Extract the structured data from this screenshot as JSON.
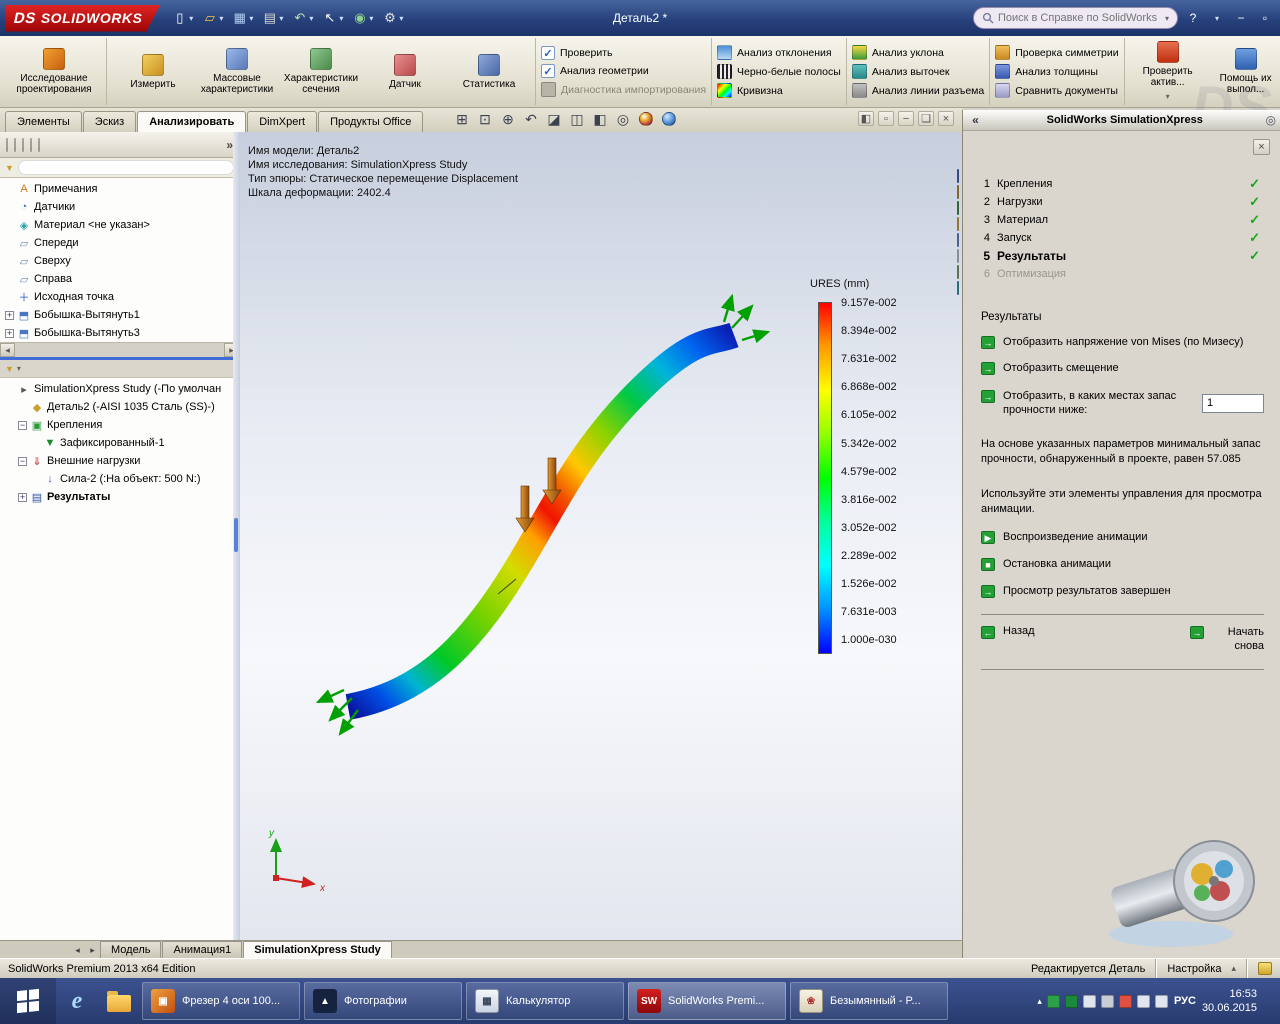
{
  "app": {
    "brand": "SOLIDWORKS",
    "title": "Деталь2 *"
  },
  "titlebar": {
    "search_placeholder": "Поиск в Справке по SolidWorks",
    "tools": [
      "new",
      "open",
      "save",
      "print",
      "undo",
      "select",
      "rebuild",
      "options"
    ],
    "window_controls": [
      "help",
      "minimize",
      "restore"
    ]
  },
  "ribbon": {
    "design_study": "Исследование проектирования",
    "tools": [
      {
        "name": "measure",
        "label": "Измерить"
      },
      {
        "name": "mass-properties",
        "label": "Массовые характеристики"
      },
      {
        "name": "section-properties",
        "label": "Характеристики сечения"
      },
      {
        "name": "sensor",
        "label": "Датчик"
      },
      {
        "name": "statistics",
        "label": "Статистика"
      }
    ],
    "checks": [
      {
        "name": "verify",
        "label": "Проверить",
        "checked": true
      },
      {
        "name": "geometry-analysis",
        "label": "Анализ геометрии",
        "checked": true
      },
      {
        "name": "import-diagnostics",
        "label": "Диагностика импортирования",
        "checked": false
      }
    ],
    "columns": [
      [
        {
          "name": "deviation-analysis",
          "label": "Анализ отклонения"
        },
        {
          "name": "zebra-stripes",
          "label": "Черно-белые полосы"
        },
        {
          "name": "curvature",
          "label": "Кривизна"
        }
      ],
      [
        {
          "name": "draft-analysis",
          "label": "Анализ уклона"
        },
        {
          "name": "undercut-analysis",
          "label": "Анализ выточек"
        },
        {
          "name": "parting-line-analysis",
          "label": "Анализ линии разъема"
        }
      ],
      [
        {
          "name": "symmetry-check",
          "label": "Проверка симметрии"
        },
        {
          "name": "thickness-analysis",
          "label": "Анализ толщины"
        },
        {
          "name": "compare-documents",
          "label": "Сравнить документы"
        }
      ]
    ],
    "right_tools": [
      {
        "name": "check-active",
        "label": "Проверить актив..."
      },
      {
        "name": "help-complete",
        "label": "Помощь их выпол..."
      }
    ]
  },
  "command_tabs": [
    {
      "label": "Элементы",
      "active": false
    },
    {
      "label": "Эскиз",
      "active": false
    },
    {
      "label": "Анализировать",
      "active": true
    },
    {
      "label": "DimXpert",
      "active": false
    },
    {
      "label": "Продукты Office",
      "active": false
    }
  ],
  "feature_tree": [
    {
      "icon": "annotations",
      "label": "Примечания"
    },
    {
      "icon": "sensors",
      "label": "Датчики"
    },
    {
      "icon": "material",
      "label": "Материал <не указан>"
    },
    {
      "icon": "plane",
      "label": "Спереди"
    },
    {
      "icon": "plane",
      "label": "Сверху"
    },
    {
      "icon": "plane",
      "label": "Справа"
    },
    {
      "icon": "origin",
      "label": "Исходная точка"
    },
    {
      "icon": "boss-extrude",
      "label": "Бобышка-Вытянуть1",
      "expand": "+"
    },
    {
      "icon": "boss-extrude",
      "label": "Бобышка-Вытянуть3",
      "expand": "+"
    }
  ],
  "sim_tree": [
    {
      "icon": "study",
      "label": "SimulationXpress Study (-По умолчан",
      "indent": 0
    },
    {
      "icon": "part",
      "label": "Деталь2 (-AISI 1035 Сталь (SS)-)",
      "indent": 1
    },
    {
      "icon": "fixtures",
      "label": "Крепления",
      "indent": 1,
      "expand": "-"
    },
    {
      "icon": "fixed",
      "label": "Зафиксированный-1",
      "indent": 2
    },
    {
      "icon": "loads",
      "label": "Внешние нагрузки",
      "indent": 1,
      "expand": "-"
    },
    {
      "icon": "force",
      "label": "Сила-2 (:На объект: 500 N:)",
      "indent": 2
    },
    {
      "icon": "results",
      "label": "Результаты",
      "indent": 1,
      "expand": "+",
      "bold": true
    }
  ],
  "viewport": {
    "info_lines": [
      "Имя модели: Деталь2",
      "Имя исследования: SimulationXpress Study",
      "Тип эпюры: Статическое перемещение Displacement",
      "Шкала деформации: 2402.4"
    ],
    "legend": {
      "title": "URES (mm)",
      "values": [
        "9.157e-002",
        "8.394e-002",
        "7.631e-002",
        "6.868e-002",
        "6.105e-002",
        "5.342e-002",
        "4.579e-002",
        "3.816e-002",
        "3.052e-002",
        "2.289e-002",
        "1.526e-002",
        "7.631e-003",
        "1.000e-030"
      ],
      "colors": [
        "#ff0000",
        "#ffff00",
        "#00ff00",
        "#00ffff",
        "#0000ff"
      ]
    },
    "triad": {
      "x": "x",
      "y": "y"
    },
    "view_tools": [
      "zoom-fit",
      "zoom-area",
      "zoom",
      "previous-view",
      "section-view",
      "view-orientation",
      "display-style",
      "hide-show-items",
      "appearances",
      "scene"
    ],
    "side_tools": [
      "monitor",
      "home",
      "report",
      "folder",
      "display",
      "render",
      "spreadsheet",
      "mesh"
    ]
  },
  "right_panel": {
    "title": "SolidWorks SimulationXpress",
    "steps": [
      {
        "n": "1",
        "label": "Крепления",
        "done": true
      },
      {
        "n": "2",
        "label": "Нагрузки",
        "done": true
      },
      {
        "n": "3",
        "label": "Материал",
        "done": true
      },
      {
        "n": "4",
        "label": "Запуск",
        "done": true
      },
      {
        "n": "5",
        "label": "Результаты",
        "done": true,
        "current": true
      },
      {
        "n": "6",
        "label": "Оптимизация",
        "pending": true
      }
    ],
    "section_title": "Результаты",
    "actions": [
      {
        "name": "show-von-mises",
        "icon": "arrow",
        "label": "Отобразить напряжение von Mises (по Мизесу)"
      },
      {
        "name": "show-displacement",
        "icon": "arrow",
        "label": "Отобразить смещение"
      }
    ],
    "fos_label": "Отобразить, в каких местах запас прочности ниже:",
    "fos_value": "1",
    "paragraph1": "На основе указанных параметров минимальный запас прочности, обнаруженный в проекте, равен 57.085",
    "paragraph2": "Используйте эти элементы управления для просмотра анимации.",
    "anim_actions": [
      {
        "name": "play-animation",
        "icon": "play",
        "label": "Воспроизведение анимации"
      },
      {
        "name": "stop-animation",
        "icon": "stop",
        "label": "Остановка анимации"
      },
      {
        "name": "done-viewing-results",
        "icon": "arrow",
        "label": "Просмотр результатов завершен"
      }
    ],
    "back_label": "Назад",
    "restart_label": "Начать снова"
  },
  "model_tabs": [
    {
      "label": "Модель",
      "active": false
    },
    {
      "label": "Анимация1",
      "active": false
    },
    {
      "label": "SimulationXpress Study",
      "active": true
    }
  ],
  "statusbar": {
    "left": "SolidWorks Premium 2013 x64 Edition",
    "editing": "Редактируется Деталь",
    "settings": "Настройка"
  },
  "taskbar": {
    "apps": [
      {
        "icon": "photo-viewer",
        "label": "Фрезер 4 оси 100..."
      },
      {
        "icon": "photos",
        "label": "Фотографии"
      },
      {
        "icon": "calculator",
        "label": "Калькулятор"
      },
      {
        "icon": "solidworks",
        "label": "SolidWorks Premi...",
        "active": true
      },
      {
        "icon": "paint",
        "label": "Безымянный - P..."
      }
    ],
    "tray_icons": [
      "expand-tray",
      "security",
      "eco",
      "display",
      "usb",
      "alert",
      "network",
      "volume"
    ],
    "language": "РУС",
    "time": "16:53",
    "date": "30.06.2015"
  }
}
